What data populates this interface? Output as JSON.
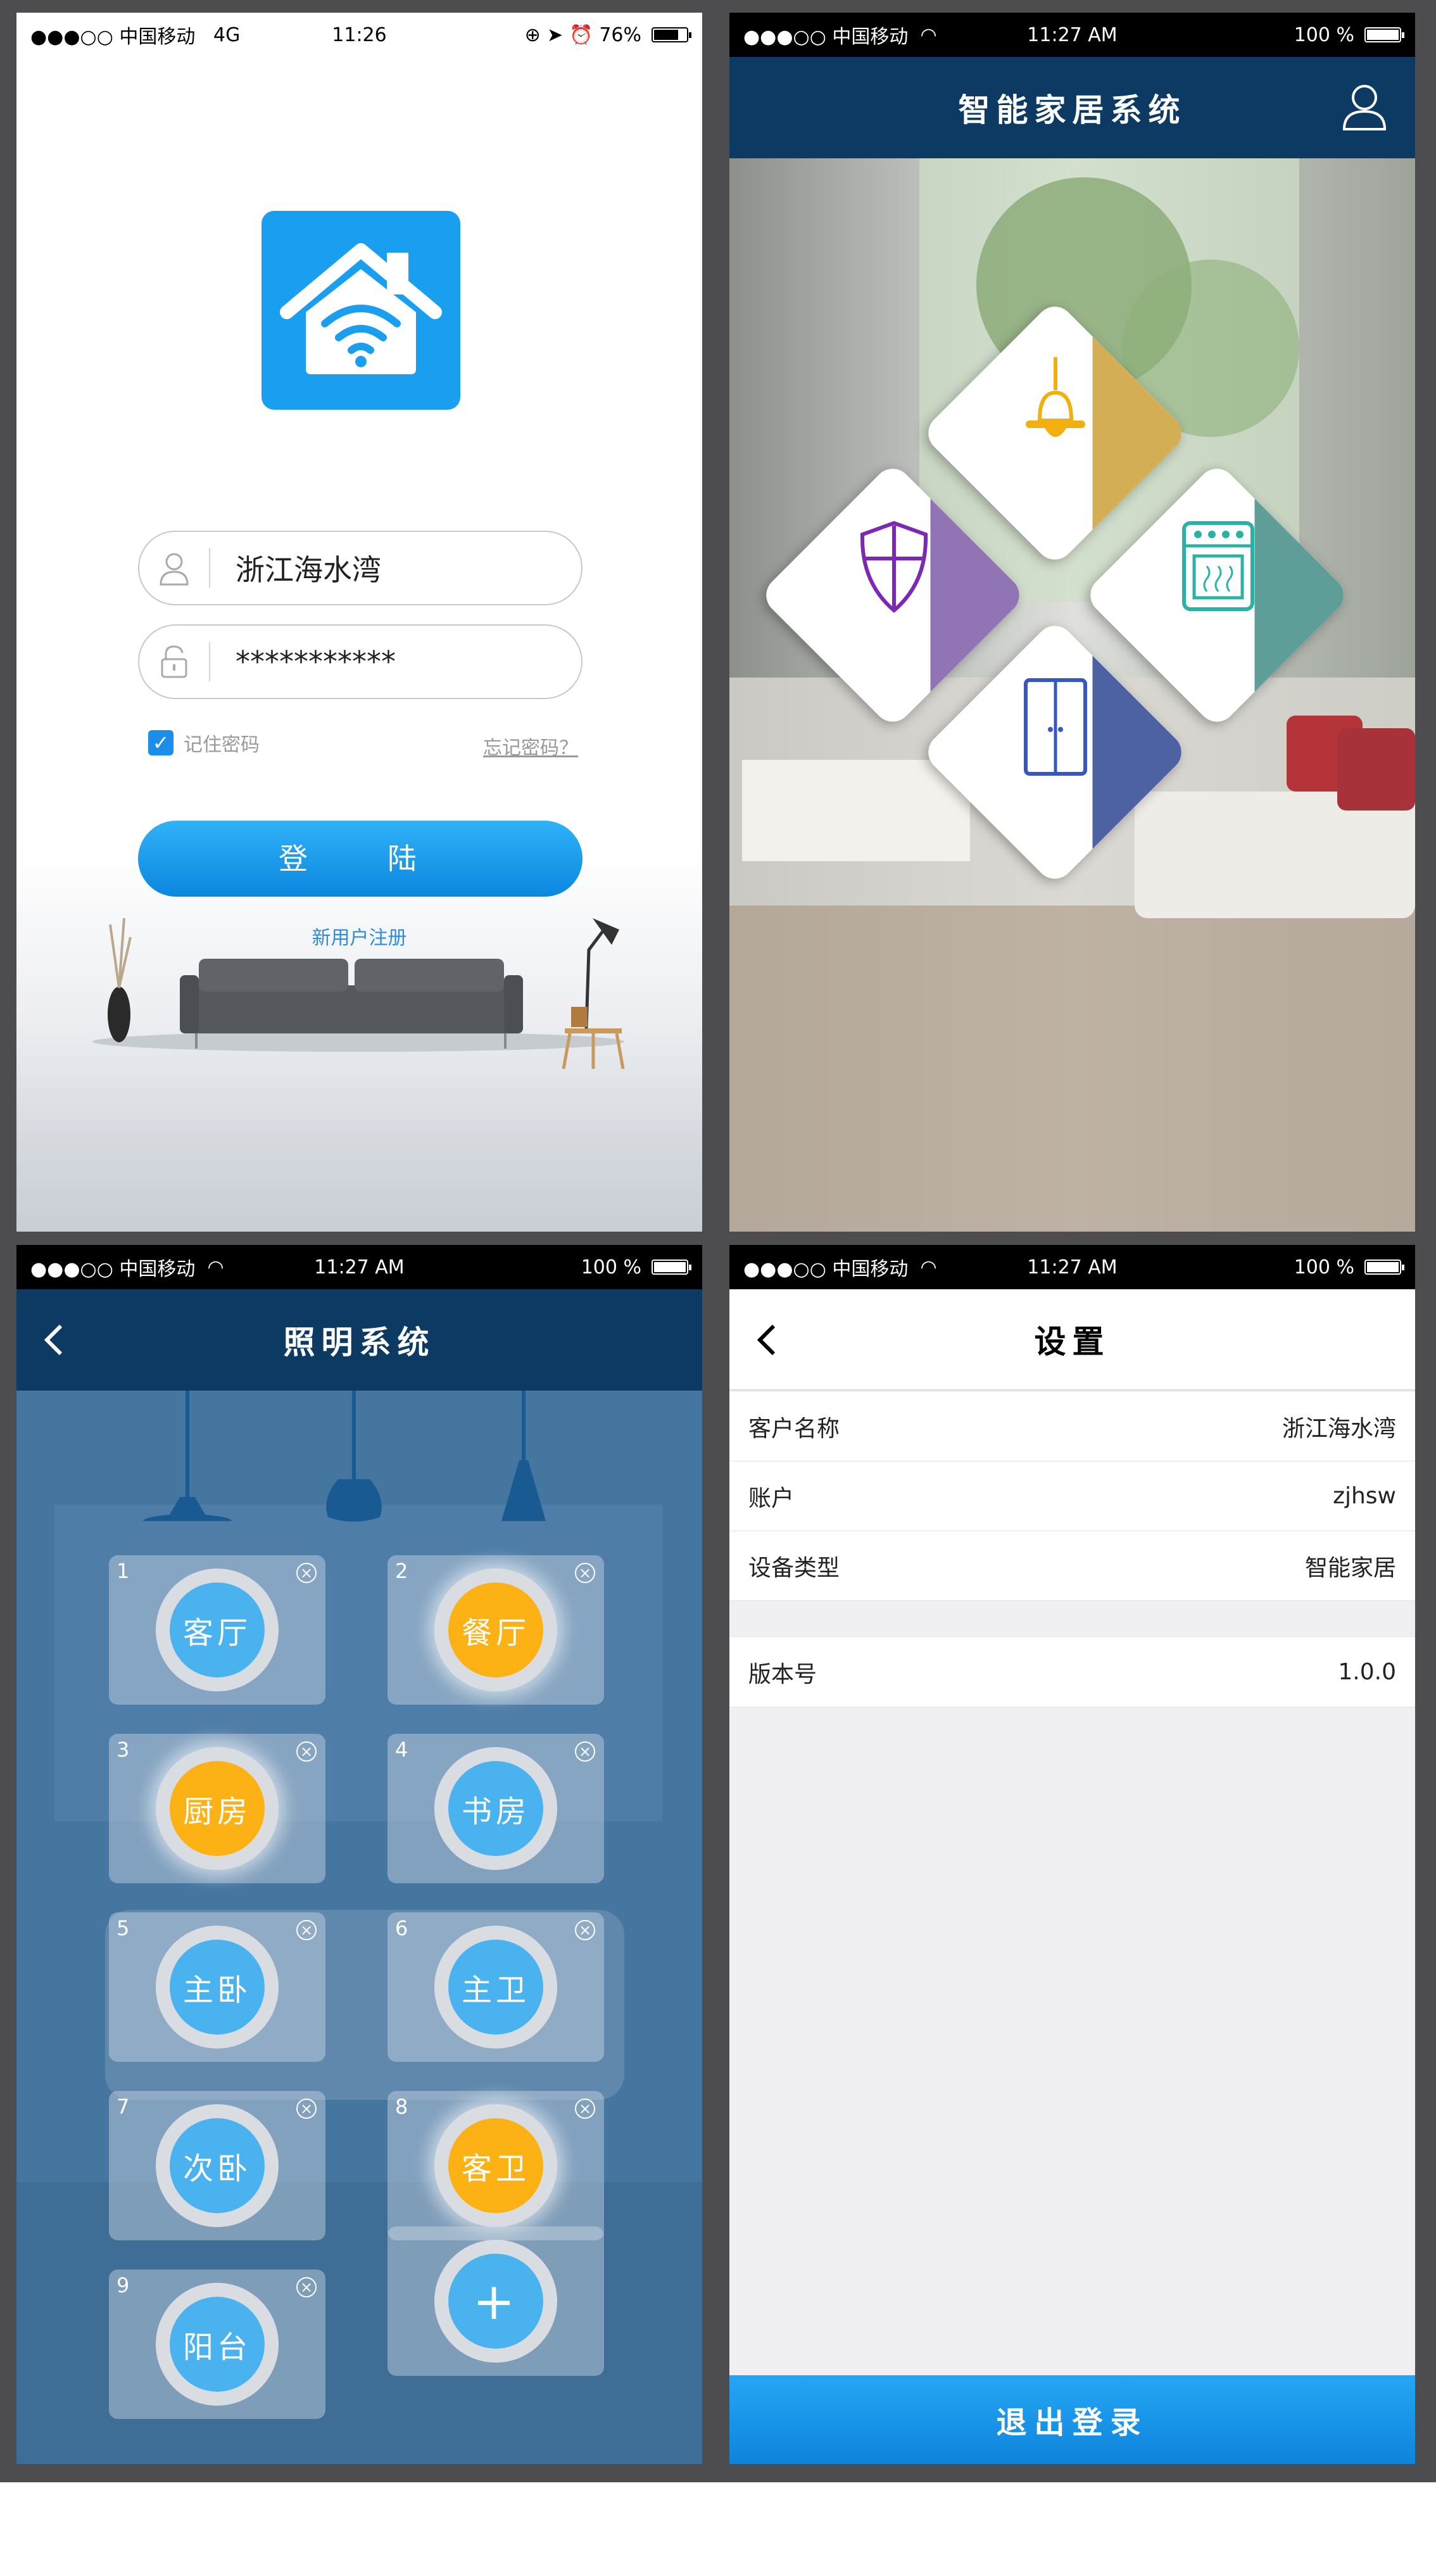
{
  "status_login": {
    "carrier": "●●●○○ 中国移动",
    "network": "4G",
    "time": "11:26",
    "battery": "76%"
  },
  "status_common": {
    "carrier": "●●●○○ 中国移动",
    "time": "11:27 AM",
    "battery": "100 %"
  },
  "login": {
    "username": "浙江海水湾",
    "password": "***********",
    "remember_label": "记住密码",
    "remember_checked": true,
    "forgot_label": "忘记密码？",
    "login_button": "登　陆",
    "register_link": "新用户注册"
  },
  "home": {
    "title": "智能家居系统",
    "tiles": [
      {
        "label": "照明",
        "color": "#d4ae55"
      },
      {
        "label": "安防",
        "color": "#9174b4"
      },
      {
        "label": "电器",
        "color": "#5f9e98"
      },
      {
        "label": "门禁",
        "color": "#4d62a3"
      }
    ]
  },
  "lighting": {
    "title": "照明系统",
    "rooms": [
      {
        "num": "1",
        "name": "客厅",
        "on": false
      },
      {
        "num": "2",
        "name": "餐厅",
        "on": true
      },
      {
        "num": "3",
        "name": "厨房",
        "on": true
      },
      {
        "num": "4",
        "name": "书房",
        "on": false
      },
      {
        "num": "5",
        "name": "主卧",
        "on": false
      },
      {
        "num": "6",
        "name": "主卫",
        "on": false
      },
      {
        "num": "7",
        "name": "次卧",
        "on": false
      },
      {
        "num": "8",
        "name": "客卫",
        "on": true
      },
      {
        "num": "9",
        "name": "阳台",
        "on": false
      }
    ],
    "add_label": "+"
  },
  "settings": {
    "title": "设置",
    "rows": [
      {
        "label": "客户名称",
        "value": "浙江海水湾"
      },
      {
        "label": "账户",
        "value": "zjhsw"
      },
      {
        "label": "设备类型",
        "value": "智能家居"
      }
    ],
    "version": {
      "label": "版本号",
      "value": "1.0.0"
    },
    "logout": "退出登录"
  }
}
